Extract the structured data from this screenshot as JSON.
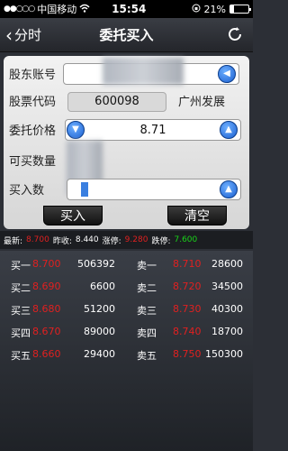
{
  "status": {
    "carrier": "中国移动",
    "time": "15:54",
    "battery": "21%",
    "battery_level": 0.21
  },
  "nav": {
    "back_label": "分时",
    "title": "委托买入"
  },
  "form": {
    "account_label": "股东账号",
    "account_value": "",
    "code_label": "股票代码",
    "code_value": "600098",
    "stock_name": "广州发展",
    "price_label": "委托价格",
    "price_value": "8.71",
    "available_label": "可买数量",
    "quantity_label": "买入数",
    "buy_button": "买入",
    "clear_button": "清空"
  },
  "stats": {
    "latest_label": "最新:",
    "latest_value": "8.700",
    "prev_close_label": "昨收:",
    "prev_close_value": "8.440",
    "limit_up_label": "涨停:",
    "limit_up_value": "9.280",
    "limit_down_label": "跌停:",
    "limit_down_value": "7.600"
  },
  "quotes": {
    "buy": [
      {
        "label": "买一",
        "price": "8.700",
        "volume": "506392"
      },
      {
        "label": "买二",
        "price": "8.690",
        "volume": "6600"
      },
      {
        "label": "买三",
        "price": "8.680",
        "volume": "51200"
      },
      {
        "label": "买四",
        "price": "8.670",
        "volume": "89000"
      },
      {
        "label": "买五",
        "price": "8.660",
        "volume": "29400"
      }
    ],
    "sell": [
      {
        "label": "卖一",
        "price": "8.710",
        "volume": "28600"
      },
      {
        "label": "卖二",
        "price": "8.720",
        "volume": "34500"
      },
      {
        "label": "卖三",
        "price": "8.730",
        "volume": "40300"
      },
      {
        "label": "卖四",
        "price": "8.740",
        "volume": "18700"
      },
      {
        "label": "卖五",
        "price": "8.750",
        "volume": "150300"
      }
    ]
  }
}
